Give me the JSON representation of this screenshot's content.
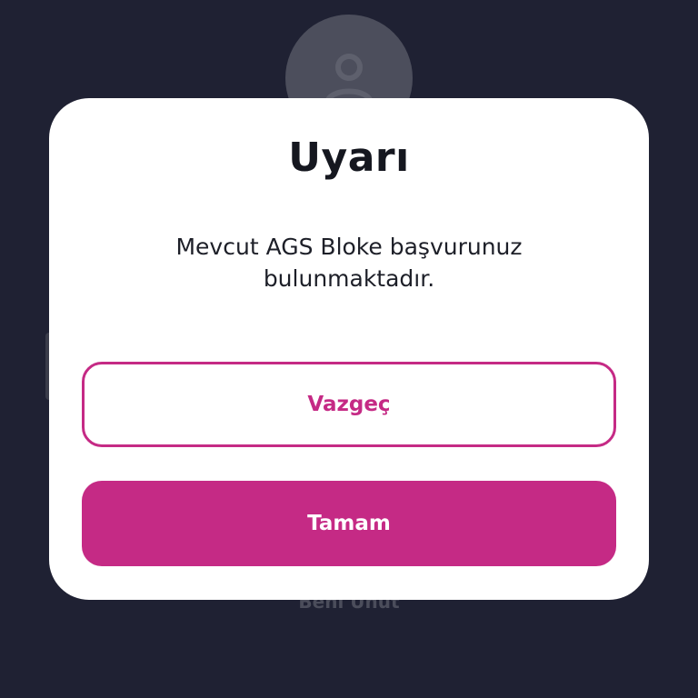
{
  "background": {
    "forget_link": "Beni Unut",
    "avatar_icon": "user-icon"
  },
  "dialog": {
    "title": "Uyarı",
    "message_line1": "Mevcut AGS Bloke başvurunuz",
    "message_line2": "bulunmaktadır.",
    "cancel_label": "Vazgeç",
    "ok_label": "Tamam"
  },
  "colors": {
    "backdrop": "#1f2133",
    "accent": "#c52a85",
    "dialog_bg": "#ffffff",
    "title_text": "#15171f"
  }
}
